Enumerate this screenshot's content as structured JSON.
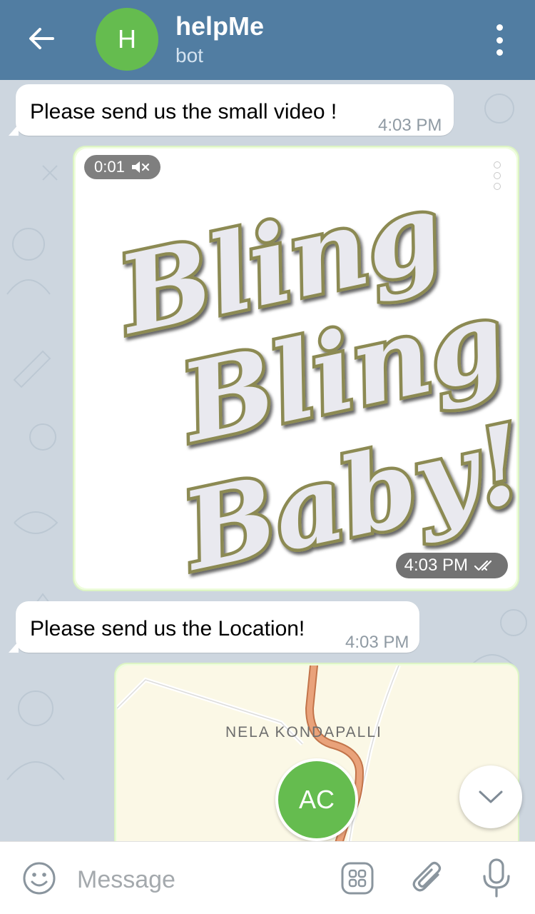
{
  "header": {
    "avatar_initial": "H",
    "title": "helpMe",
    "subtitle": "bot",
    "avatar_color": "#65bc4f",
    "bar_color": "#517da2"
  },
  "messages": [
    {
      "type": "incoming-text",
      "text": "Please send us the small video !",
      "time": "4:03 PM"
    },
    {
      "type": "outgoing-video",
      "duration": "0:01",
      "time": "4:03 PM",
      "status": "read",
      "sticker_text": "Bling Bling Baby!"
    },
    {
      "type": "incoming-text",
      "text": "Please send us the Location!",
      "time": "4:03 PM"
    },
    {
      "type": "outgoing-location",
      "map_label": "NELA KONDAPALLI",
      "avatar_initials": "AC"
    }
  ],
  "input": {
    "placeholder": "Message"
  },
  "icons": {
    "back": "back-arrow-icon",
    "menu": "more-vertical-icon",
    "emoji": "emoji-icon",
    "bot_commands": "bot-commands-icon",
    "attach": "paperclip-icon",
    "mic": "microphone-icon",
    "scroll": "chevron-down-icon"
  }
}
